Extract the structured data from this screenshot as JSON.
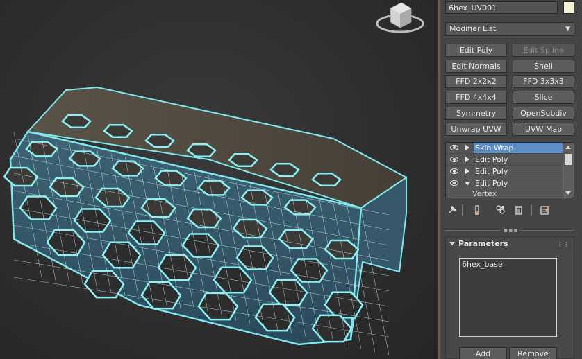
{
  "object": {
    "name": "6hex_UV001",
    "color": "#f4f2d2"
  },
  "modifier_list": {
    "label": "Modifier List"
  },
  "modifier_buttons": [
    {
      "label": "Edit Poly",
      "enabled": true
    },
    {
      "label": "Edit Spline",
      "enabled": false
    },
    {
      "label": "Edit Normals",
      "enabled": true
    },
    {
      "label": "Shell",
      "enabled": true
    },
    {
      "label": "FFD 2x2x2",
      "enabled": true
    },
    {
      "label": "FFD 3x3x3",
      "enabled": true
    },
    {
      "label": "FFD 4x4x4",
      "enabled": true
    },
    {
      "label": "Slice",
      "enabled": true
    },
    {
      "label": "Symmetry",
      "enabled": true
    },
    {
      "label": "OpenSubdiv",
      "enabled": true
    },
    {
      "label": "Unwrap UVW",
      "enabled": true
    },
    {
      "label": "UVW Map",
      "enabled": true
    }
  ],
  "stack": {
    "items": [
      {
        "label": "Skin Wrap",
        "selected": true,
        "expanded": false
      },
      {
        "label": "Edit Poly",
        "selected": false,
        "expanded": false
      },
      {
        "label": "Edit Poly",
        "selected": false,
        "expanded": false
      },
      {
        "label": "Edit Poly",
        "selected": false,
        "expanded": true
      }
    ],
    "sub_item": "Vertex"
  },
  "parameters": {
    "title": "Parameters",
    "list_items": [
      "6hex_base"
    ],
    "add_label": "Add",
    "remove_label": "Remove"
  },
  "colors": {
    "wireframe": "#7fe8ee",
    "panel_bg": "#444444",
    "selection": "#5b8dc7"
  },
  "icons": {
    "tools": [
      "pin-stack-icon",
      "show-end-result-icon",
      "make-unique-icon",
      "remove-modifier-icon",
      "configure-modifier-sets-icon"
    ],
    "viewcube": "viewcube-icon"
  }
}
